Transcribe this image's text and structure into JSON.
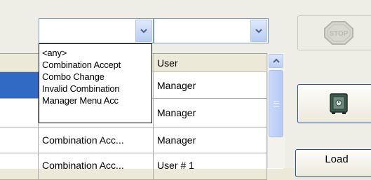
{
  "filters": {
    "combo1_value": "",
    "combo2_value": ""
  },
  "dropdown": {
    "options": [
      "<any>",
      "Combination Accept",
      "Combo Change",
      "Invalid Combination",
      "Manager Menu Acc"
    ]
  },
  "grid": {
    "header_user": "User",
    "rows": [
      {
        "event": "",
        "user": "Manager",
        "selected": true
      },
      {
        "event": "",
        "user": "Manager",
        "selected": false
      },
      {
        "event": "Combination Acc...",
        "user": "Manager",
        "selected": false
      },
      {
        "event": "Combination Acc...",
        "user": "User # 1",
        "selected": false
      }
    ]
  },
  "buttons": {
    "stop_label": "STOP",
    "load_label": "Load",
    "safe_icon": "safe-icon"
  },
  "colors": {
    "selection": "#316ac5",
    "accent_border": "#2d4f8f"
  }
}
